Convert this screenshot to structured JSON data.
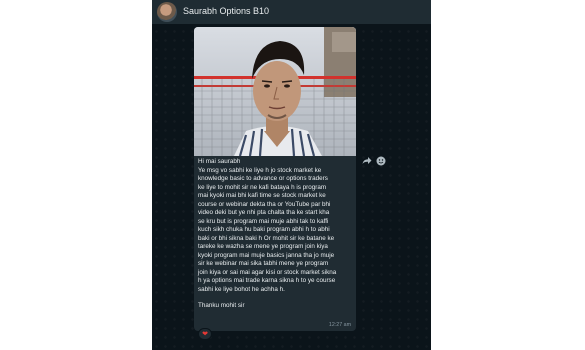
{
  "header": {
    "contact_name": "Saurabh Options B10"
  },
  "message": {
    "greeting": "Hi mai saurabh",
    "body": "Ye msg vo sabhi ke liye h jo  stock market ke\nknowledge basic to advance or options traders\nke liye to mohit sir ne kafi bataya h is program\nmai kyoki mai bhi kafi time se stock market ke\ncourse or webinar dekta tha or YouTube par bhi\nvideo deki but ye nhi pta chalta tha ke start kha\nse kru but is program mai muje abhi tak to kaffi\nkuch sikh chuka hu baki program abhi h to abhi\nbaki or bhi sikna baki h Or mohit sir ke batane ke\ntareke ke wazha se mene ye program join kiya\nkyoki program mai muje basics janna tha jo muje\nsir ke webinar mai sika tabhi mene ye program\njoin kiya or sai mai agar kisi or stock market sikna\nh ya options mai trade karna sikna h to ye course\nsabhi ke liye bohot he achha h.",
    "signoff": "Thanku mohit sir",
    "time": "12:27 am",
    "reaction": "❤"
  },
  "icons": {
    "forward": "forward-arrow-icon",
    "emoji": "emoji-smiley-icon"
  },
  "colors": {
    "chat_background": "#0b141a",
    "header_background": "#1f2c33",
    "bubble_background": "#202c33",
    "text": "#e9edef",
    "timestamp": "#8696a0"
  }
}
